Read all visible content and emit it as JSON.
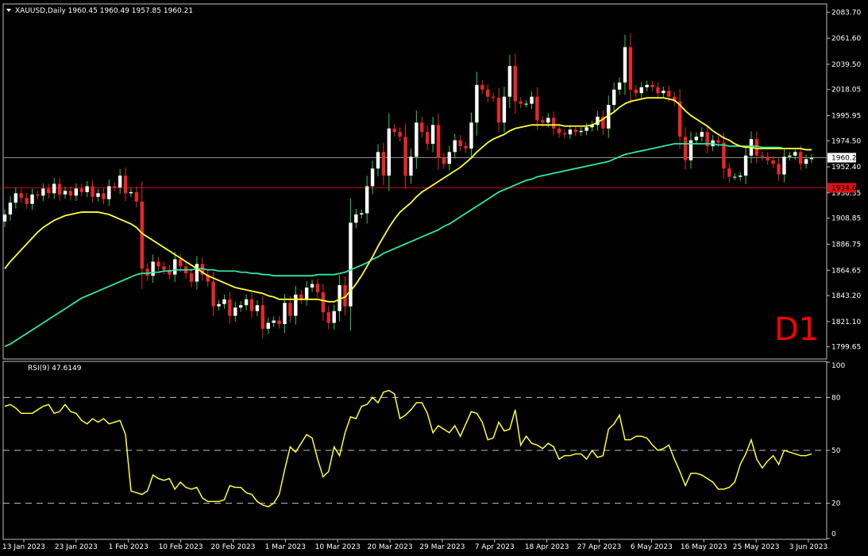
{
  "symbol_header": "XAUUSD,Daily  1960.45 1960.49 1957.85 1960.21",
  "timeframe_label": "D1",
  "colors": {
    "background": "#000000",
    "frame": "#c0c0c0",
    "bull": "#ffffff",
    "bear": "#e8262a",
    "wick_bull": "#2fd03a",
    "wick_bear": "#e8262a",
    "ma_fast": "#ffff33",
    "ma_slow": "#2ee8a0",
    "rsi": "#ffff33",
    "bid_line": "#8c8c8c",
    "level_line": "#c00000",
    "label_accent": "#ff0000"
  },
  "chart_data": [
    {
      "type": "candlestick",
      "series_name": "XAUUSD,Daily",
      "ylim": [
        1790,
        2090
      ],
      "price_ticks": [
        "2083.70",
        "2061.60",
        "2039.50",
        "2018.05",
        "1995.95",
        "1974.50",
        "1952.40",
        "1930.35",
        "1908.85",
        "1886.75",
        "1864.65",
        "1843.20",
        "1821.10",
        "1799.65"
      ],
      "current_price": "1960.21",
      "horizontal_level": "1934.63",
      "date_labels": [
        "13 Jan 2023",
        "23 Jan 2023",
        "1 Feb 2023",
        "10 Feb 2023",
        "20 Feb 2023",
        "1 Mar 2023",
        "10 Mar 2023",
        "20 Mar 2023",
        "29 Mar 2023",
        "7 Apr 2023",
        "18 Apr 2023",
        "27 Apr 2023",
        "6 May 2023",
        "16 May 2023",
        "25 May 2023",
        "3 Jun 2023"
      ],
      "closes": [
        1912,
        1922,
        1930,
        1926,
        1921,
        1929,
        1928,
        1934,
        1930,
        1938,
        1929,
        1932,
        1928,
        1934,
        1931,
        1936,
        1927,
        1930,
        1925,
        1936,
        1935,
        1945,
        1930,
        1931,
        1923,
        1866,
        1860,
        1872,
        1868,
        1865,
        1861,
        1874,
        1868,
        1862,
        1855,
        1870,
        1861,
        1855,
        1834,
        1836,
        1840,
        1826,
        1833,
        1835,
        1840,
        1830,
        1835,
        1815,
        1820,
        1822,
        1819,
        1837,
        1826,
        1844,
        1840,
        1850,
        1853,
        1846,
        1829,
        1820,
        1830,
        1852,
        1834,
        1905,
        1912,
        1913,
        1936,
        1951,
        1965,
        1945,
        1985,
        1982,
        1978,
        1945,
        1961,
        1990,
        1982,
        1972,
        1988,
        1960,
        1955,
        1965,
        1975,
        1970,
        1968,
        1990,
        2022,
        2018,
        2012,
        2011,
        1990,
        2012,
        2038,
        2008,
        2006,
        2006,
        2012,
        1992,
        1990,
        1994,
        1985,
        1981,
        1980,
        1984,
        1982,
        1983,
        1986,
        1988,
        1995,
        1985,
        2005,
        2018,
        2024,
        2054,
        2018,
        2015,
        2020,
        2022,
        2020,
        2015,
        2017,
        2012,
        2008,
        1978,
        1958,
        1975,
        1978,
        1982,
        1970,
        1975,
        1973,
        1951,
        1944,
        1944,
        1945,
        1962,
        1976,
        1962,
        1961,
        1958,
        1955,
        1946,
        1961,
        1962,
        1965,
        1955,
        1959,
        1960
      ],
      "ma_fast_values": [
        1866,
        1872,
        1877,
        1882,
        1887,
        1892,
        1897,
        1901,
        1904,
        1907,
        1909,
        1911,
        1912,
        1913,
        1914,
        1914,
        1914,
        1914,
        1913,
        1912,
        1910,
        1908,
        1906,
        1904,
        1901,
        1896,
        1893,
        1890,
        1887,
        1884,
        1881,
        1878,
        1875,
        1872,
        1869,
        1866,
        1863,
        1860,
        1858,
        1856,
        1854,
        1852,
        1850,
        1849,
        1848,
        1847,
        1846,
        1845,
        1843,
        1842,
        1840,
        1840,
        1840,
        1840,
        1840,
        1840,
        1840,
        1840,
        1839,
        1838,
        1838,
        1840,
        1842,
        1847,
        1853,
        1860,
        1868,
        1876,
        1885,
        1893,
        1901,
        1908,
        1914,
        1918,
        1922,
        1927,
        1931,
        1934,
        1937,
        1940,
        1943,
        1946,
        1949,
        1952,
        1956,
        1960,
        1965,
        1969,
        1973,
        1976,
        1978,
        1980,
        1983,
        1985,
        1986,
        1987,
        1988,
        1988,
        1988,
        1988,
        1988,
        1988,
        1987,
        1987,
        1987,
        1987,
        1987,
        1988,
        1990,
        1993,
        1996,
        1999,
        2003,
        2006,
        2008,
        2009,
        2010,
        2011,
        2011,
        2011,
        2011,
        2010,
        2009,
        2005,
        2000,
        1996,
        1993,
        1990,
        1987,
        1983,
        1980,
        1977,
        1975,
        1972,
        1970,
        1969,
        1969,
        1968,
        1968,
        1968,
        1968,
        1968,
        1968,
        1968,
        1968,
        1968,
        1967,
        1967
      ],
      "ma_slow_values": [
        1800,
        1802,
        1805,
        1808,
        1811,
        1814,
        1817,
        1820,
        1823,
        1826,
        1829,
        1832,
        1835,
        1838,
        1841,
        1843,
        1845,
        1847,
        1849,
        1851,
        1853,
        1855,
        1857,
        1859,
        1861,
        1862,
        1862,
        1863,
        1863,
        1864,
        1864,
        1865,
        1865,
        1865,
        1865,
        1866,
        1866,
        1865,
        1865,
        1864,
        1864,
        1864,
        1864,
        1863,
        1863,
        1862,
        1862,
        1861,
        1861,
        1860,
        1860,
        1860,
        1860,
        1860,
        1860,
        1860,
        1860,
        1861,
        1861,
        1861,
        1861,
        1862,
        1863,
        1865,
        1867,
        1869,
        1871,
        1874,
        1876,
        1879,
        1881,
        1883,
        1885,
        1887,
        1889,
        1891,
        1893,
        1895,
        1897,
        1899,
        1902,
        1904,
        1907,
        1910,
        1913,
        1916,
        1919,
        1922,
        1925,
        1928,
        1931,
        1933,
        1935,
        1937,
        1939,
        1941,
        1942,
        1944,
        1945,
        1946,
        1947,
        1948,
        1949,
        1950,
        1951,
        1952,
        1953,
        1954,
        1955,
        1956,
        1957,
        1959,
        1961,
        1963,
        1964,
        1965,
        1966,
        1967,
        1968,
        1969,
        1970,
        1971,
        1972,
        1972,
        1972,
        1972,
        1972,
        1972,
        1972,
        1972,
        1971,
        1971,
        1970,
        1970,
        1970,
        1970,
        1970,
        1970,
        1969,
        1969,
        1969,
        1969,
        1968,
        1968,
        1968,
        1968,
        1967,
        1967
      ]
    },
    {
      "type": "line",
      "series_name": "RSI(9) 47.6149",
      "ylim": [
        0,
        100
      ],
      "rsi_ticks": [
        "100",
        "80",
        "50",
        "20",
        "0"
      ],
      "rsi_levels": [
        80,
        50,
        20
      ],
      "rsi_values": [
        75,
        76,
        74,
        71,
        71,
        71,
        73,
        75,
        76,
        71,
        72,
        76,
        72,
        71,
        67,
        65,
        68,
        66,
        68,
        65,
        66,
        67,
        59,
        27,
        26,
        25,
        27,
        36,
        34,
        33,
        34,
        28,
        32,
        29,
        28,
        29,
        23,
        21,
        21,
        21,
        22,
        30,
        29,
        29,
        26,
        25,
        21,
        19,
        18,
        20,
        25,
        39,
        52,
        49,
        54,
        59,
        57,
        45,
        35,
        38,
        52,
        47,
        60,
        69,
        68,
        75,
        76,
        80,
        77,
        83,
        84,
        82,
        68,
        70,
        73,
        77,
        77,
        71,
        60,
        64,
        62,
        60,
        64,
        58,
        65,
        72,
        71,
        66,
        56,
        57,
        66,
        61,
        62,
        73,
        53,
        58,
        54,
        53,
        51,
        54,
        52,
        45,
        47,
        47,
        48,
        48,
        45,
        50,
        46,
        47,
        62,
        65,
        70,
        56,
        56,
        58,
        58,
        57,
        53,
        50,
        51,
        53,
        45,
        38,
        30,
        37,
        37,
        36,
        34,
        32,
        28,
        28,
        29,
        32,
        42,
        48,
        56,
        45,
        40,
        44,
        47,
        42,
        50,
        49,
        48,
        47,
        47,
        48
      ],
      "indicator_value": "47.6149"
    }
  ]
}
